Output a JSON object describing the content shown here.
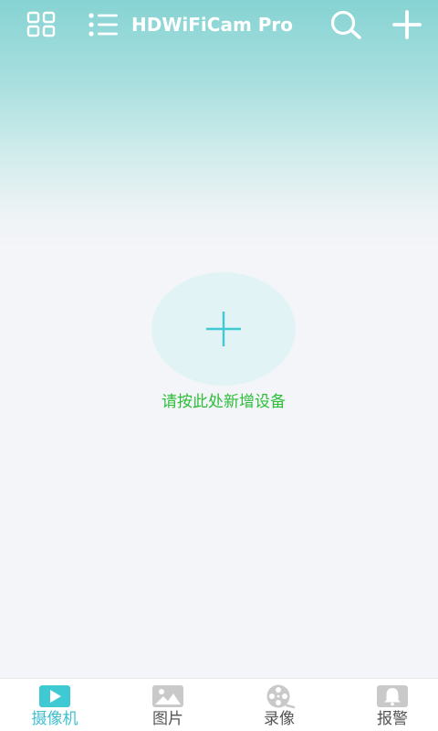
{
  "header": {
    "title": "HDWiFiCam Pro",
    "grid_icon": "grid-view-icon",
    "list_icon": "list-view-icon",
    "search_icon": "search-icon",
    "add_icon": "plus-icon"
  },
  "main": {
    "add_device_icon": "plus-icon",
    "hint": "请按此处新增设备"
  },
  "bottom_nav": {
    "items": [
      {
        "label": "摄像机",
        "icon": "play-icon",
        "active": true
      },
      {
        "label": "图片",
        "icon": "image-icon",
        "active": false
      },
      {
        "label": "录像",
        "icon": "film-reel-icon",
        "active": false
      },
      {
        "label": "报警",
        "icon": "bell-icon",
        "active": false
      }
    ]
  },
  "colors": {
    "header_gradient_top": "#86d3d3",
    "background": "#f3f5f8",
    "accent": "#3fbfcf",
    "hint_text": "#2dbd3a",
    "inactive_icon": "#c9c9c9"
  }
}
